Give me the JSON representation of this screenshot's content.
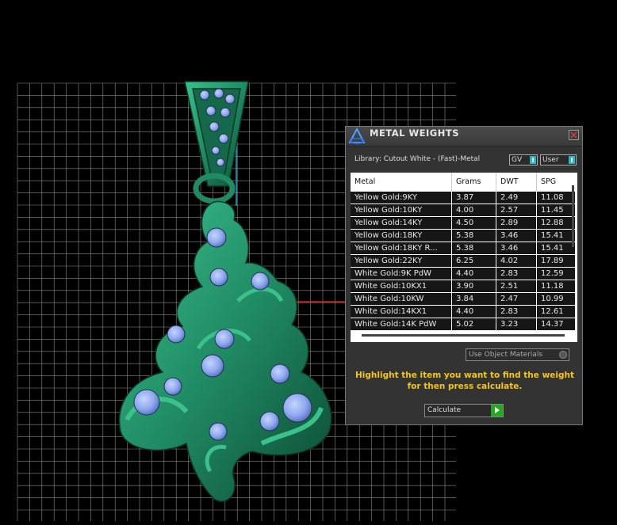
{
  "panel": {
    "title": "METAL WEIGHTS",
    "library": "Library: Cutout White - (Fast)-Metal",
    "toggle_gv": "GV",
    "toggle_user": "User",
    "use_object_materials": "Use Object Materials",
    "hint": "Highlight the item you want to find the weight for then press calculate.",
    "calculate": "Calculate",
    "icons": [
      "app-logo-icon",
      "close-icon",
      "play-icon"
    ]
  },
  "table": {
    "headers": [
      "Metal",
      "Grams",
      "DWT",
      "SPG"
    ],
    "rows": [
      [
        "Yellow Gold:9KY",
        "3.87",
        "2.49",
        "11.08"
      ],
      [
        "Yellow Gold:10KY",
        "4.00",
        "2.57",
        "11.45"
      ],
      [
        "Yellow Gold:14KY",
        "4.50",
        "2.89",
        "12.88"
      ],
      [
        "Yellow Gold:18KY",
        "5.38",
        "3.46",
        "15.41"
      ],
      [
        "Yellow Gold:18KY R...",
        "5.38",
        "3.46",
        "15.41"
      ],
      [
        "Yellow Gold:22KY",
        "6.25",
        "4.02",
        "17.89"
      ],
      [
        "White Gold:9K PdW",
        "4.40",
        "2.83",
        "12.59"
      ],
      [
        "White Gold:10KX1",
        "3.90",
        "2.51",
        "11.18"
      ],
      [
        "White Gold:10KW",
        "3.84",
        "2.47",
        "10.99"
      ],
      [
        "White Gold:14KX1",
        "4.40",
        "2.83",
        "12.61"
      ],
      [
        "White Gold:14K PdW",
        "5.02",
        "3.23",
        "14.37"
      ]
    ]
  },
  "colors": {
    "background": "#000000",
    "grid": "#8a8a8a",
    "model_green": "#1f8a63",
    "gem_blue": "#8fa9ee",
    "axis_red": "#d22222",
    "panel": "#333333",
    "hint_text": "#f5c518"
  }
}
